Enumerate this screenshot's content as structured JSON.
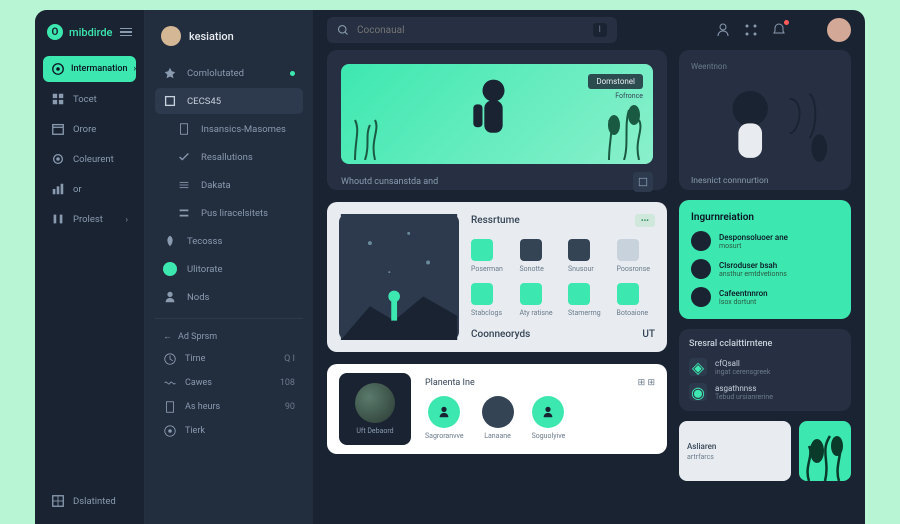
{
  "brand": {
    "initial": "O",
    "name": "mibdirde"
  },
  "search": {
    "placeholder": "Coconaual",
    "shortcut": "I"
  },
  "colors": {
    "accent": "#3de8b0",
    "bg": "#1a2332",
    "panel": "#263042"
  },
  "sidebar1": {
    "active": {
      "label": "Intermanation",
      "chev": "›"
    },
    "items": [
      {
        "icon": "grid-icon",
        "label": "Tocet"
      },
      {
        "icon": "calendar-icon",
        "label": "Orore"
      },
      {
        "icon": "gear-icon",
        "label": "Coleurent"
      },
      {
        "icon": "chart-icon",
        "label": "or"
      },
      {
        "icon": "bars-icon",
        "label": "Prolest",
        "chev": "›"
      }
    ],
    "bottom": {
      "icon": "dashboard-icon",
      "label": "Dslatinted"
    }
  },
  "sidebar2": {
    "user": "kesiation",
    "items": [
      {
        "icon": "spark-icon",
        "label": "Comlolutated",
        "dot": true
      },
      {
        "icon": "box-icon",
        "label": "CECS45",
        "sel": true
      },
      {
        "icon": "doc-icon",
        "label": "Insansics-Masomes",
        "indent": true
      },
      {
        "icon": "check-icon",
        "label": "Resallutions",
        "indent": true
      },
      {
        "icon": "list-icon",
        "label": "Dakata",
        "indent": true
      },
      {
        "icon": "menu-icon",
        "label": "Pus liracelsitets",
        "indent": true
      },
      {
        "icon": "leaf-icon",
        "label": "Tecosss"
      },
      {
        "icon": "circle-icon",
        "label": "Ulitorate",
        "teal": true
      },
      {
        "icon": "user-icon",
        "label": "Nods"
      }
    ],
    "section2_label": "Ad Sprsm",
    "rows": [
      {
        "icon": "clock-icon",
        "label": "Tirne",
        "val": "Q I"
      },
      {
        "icon": "wave-icon",
        "label": "Cawes",
        "val": "108"
      },
      {
        "icon": "hour-icon",
        "label": "As heurs",
        "val": "90"
      },
      {
        "icon": "target-icon",
        "label": "Tierk",
        "val": ""
      }
    ]
  },
  "hero": {
    "tag1": "Domstonel",
    "tag2": "Fofronce",
    "footer": "Whoutd cunsanstda and"
  },
  "mid": {
    "title": "Ressrtume",
    "badge": "",
    "tiles": [
      {
        "c": "teal",
        "lbl": "Poserman"
      },
      {
        "c": "dark",
        "lbl": "Sonotte"
      },
      {
        "c": "dark",
        "lbl": "Snusour"
      },
      {
        "c": "light",
        "lbl": "Poosronse"
      },
      {
        "c": "teal",
        "lbl": "Stabclogs"
      },
      {
        "c": "teal",
        "lbl": "Aty ratisne"
      },
      {
        "c": "teal",
        "lbl": "Stamerrng"
      },
      {
        "c": "teal",
        "lbl": "Botoaione"
      }
    ],
    "footer_left": "Coonneoryds",
    "footer_right": "UT"
  },
  "bot": {
    "title": "Planenta Ine",
    "illus_label": "Uft Debaord",
    "avatars": [
      {
        "c": "teal",
        "lbl": "Sagroranvve"
      },
      {
        "c": "dark",
        "lbl": "Lanaane"
      },
      {
        "c": "teal",
        "lbl": "Soguolyive"
      }
    ]
  },
  "right": {
    "card1": {
      "head": "Weentnon",
      "foot": "Inesnict connnurtion"
    },
    "card2": {
      "title": "Ingurnreiation",
      "rows": [
        {
          "t1": "Desponsoluoer ane",
          "t2": "mosurt"
        },
        {
          "t1": "Clsroduser bsah",
          "t2": "ansthur emtdvetionns"
        },
        {
          "t1": "Cafeentnnron",
          "t2": "lsox dortunt"
        }
      ]
    },
    "card3": {
      "title": "Sresral cclaittirntene",
      "rows": [
        {
          "t1": "cfQsall",
          "t2": "ingat cerensgreek"
        },
        {
          "t1": "asgathnnss",
          "t2": "Tebud ursianrerine"
        }
      ]
    },
    "card4": {
      "t1": "Asliaren",
      "t2": "artrfarcs"
    }
  }
}
